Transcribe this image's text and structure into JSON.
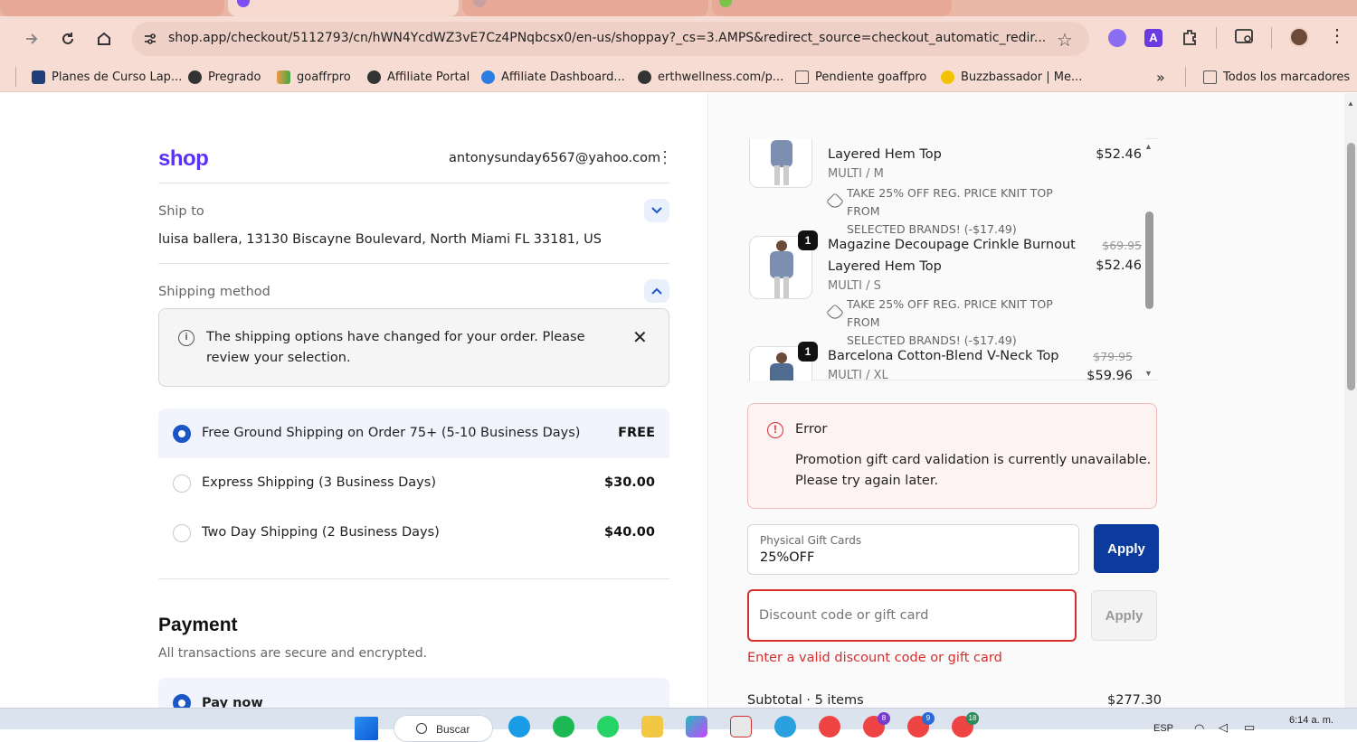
{
  "browser": {
    "url": "shop.app/checkout/5112793/cn/hWN4YcdWZ3vE7Cz4PNqbcsx0/en-us/shoppay?_cs=3.AMPS&redirect_source=checkout_automatic_redir...",
    "bookmarks": [
      {
        "label": "Planes de Curso Lap...",
        "icon": "wave-icon"
      },
      {
        "label": "Pregrado",
        "icon": "globe-icon"
      },
      {
        "label": "goaffrpro",
        "icon": "puzzle-icon"
      },
      {
        "label": "Affiliate Portal",
        "icon": "globe-icon"
      },
      {
        "label": "Affiliate Dashboard...",
        "icon": "swirl-icon"
      },
      {
        "label": "erthwellness.com/p...",
        "icon": "globe-icon"
      },
      {
        "label": "Pendiente goaffpro",
        "icon": "folder-icon"
      },
      {
        "label": "Buzzbassador | Me...",
        "icon": "bees-icon"
      }
    ],
    "bookmarks_overflow": "»",
    "all_bookmarks": "Todos los marcadores"
  },
  "checkout": {
    "logo": "shop",
    "email": "antonysunday6567@yahoo.com",
    "ship_to_label": "Ship to",
    "ship_to_address": "luisa ballera, 13130 Biscayne Boulevard, North Miami FL 33181, US",
    "shipping_method_label": "Shipping method",
    "notice_line1": "The shipping options have changed for your order. Please",
    "notice_line2": "review your selection.",
    "shipping_options": [
      {
        "label": "Free Ground Shipping on Order 75+ (5-10 Business Days)",
        "price": "FREE",
        "selected": true
      },
      {
        "label": "Express Shipping (3 Business Days)",
        "price": "$30.00",
        "selected": false
      },
      {
        "label": "Two Day Shipping (2 Business Days)",
        "price": "$40.00",
        "selected": false
      }
    ],
    "payment_title": "Payment",
    "payment_subtitle": "All transactions are secure and encrypted.",
    "pay_now_label": "Pay now"
  },
  "order": {
    "items": [
      {
        "qty": "",
        "name_line1": "",
        "name_line2": "Layered Hem Top",
        "variant": "MULTI / M",
        "discount_line1": "TAKE 25% OFF REG. PRICE KNIT TOP FROM",
        "discount_line2": "SELECTED BRANDS! (-$17.49)",
        "compare_price": "",
        "price": "$52.46"
      },
      {
        "qty": "1",
        "name_line1": "Magazine Decoupage Crinkle Burnout",
        "name_line2": "Layered Hem Top",
        "variant": "MULTI / S",
        "discount_line1": "TAKE 25% OFF REG. PRICE KNIT TOP FROM",
        "discount_line2": "SELECTED BRANDS! (-$17.49)",
        "compare_price": "$69.95",
        "price": "$52.46"
      },
      {
        "qty": "1",
        "name_line1": "Barcelona Cotton-Blend V-Neck Top",
        "name_line2": "",
        "variant": "MULTI / XL",
        "discount_line1": "",
        "discount_line2": "",
        "compare_price": "$79.95",
        "price": "$59.96"
      }
    ],
    "error_title": "Error",
    "error_line1": "Promotion gift card validation is currently unavailable.",
    "error_line2": "Please try again later.",
    "gift_card_label": "Physical Gift Cards",
    "gift_card_value": "25%OFF",
    "apply_label": "Apply",
    "discount_placeholder": "Discount code or gift card",
    "discount_apply_label": "Apply",
    "discount_error": "Enter a valid discount code or gift card",
    "subtotal_label": "Subtotal · 5 items",
    "subtotal_value": "$277.30"
  },
  "taskbar": {
    "search_label": "Buscar",
    "language": "ESP",
    "time": "6:14 a. m.",
    "badges": [
      "8",
      "9",
      "18"
    ]
  },
  "colors": {
    "tab_strip": "#eab8a6",
    "toolbar": "#f7dcd3",
    "shop_purple": "#5a31f4",
    "accent_blue": "#1a56c6",
    "apply_navy": "#0b3b9c",
    "error_red": "#d32f2f"
  }
}
